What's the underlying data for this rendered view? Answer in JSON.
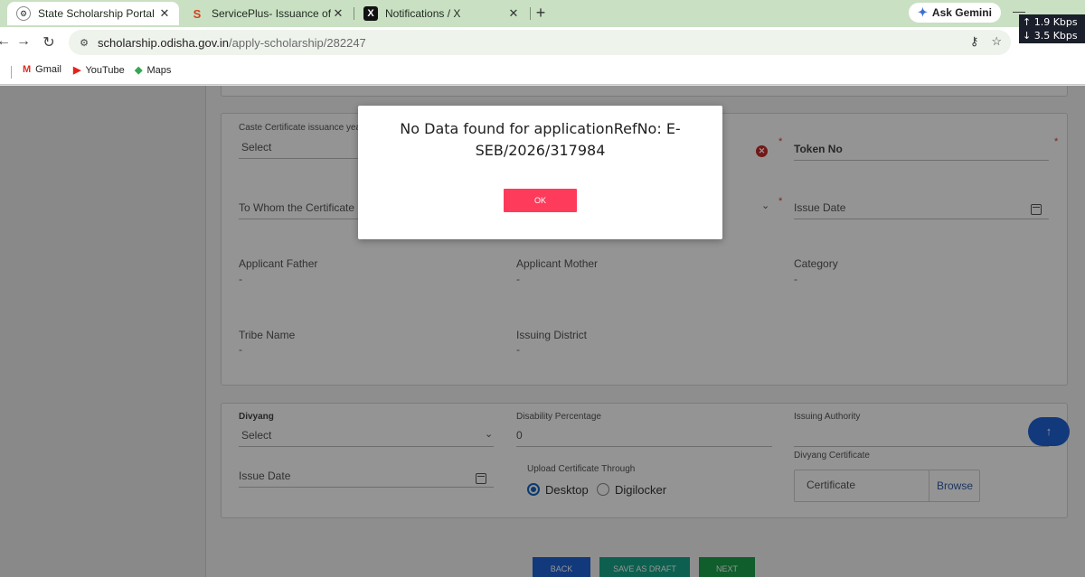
{
  "browser": {
    "tabs": [
      {
        "title": "State Scholarship Portal",
        "close": "✕"
      },
      {
        "title": "ServicePlus- Issuance of SEBC C",
        "close": "✕"
      },
      {
        "title": "Notifications / X",
        "close": "✕"
      }
    ],
    "new_tab": "+",
    "gemini_label": "Ask Gemini",
    "net_up": "↑ 1.9 Kbps",
    "net_down": "↓ 3.5 Kbps",
    "url_domain": "scholarship.odisha.gov.in",
    "url_path": "/apply-scholarship/282247",
    "bookmarks": [
      "Gmail",
      "YouTube",
      "Maps"
    ]
  },
  "form": {
    "caste_year_label": "Caste Certificate issuance year",
    "caste_year_value": "Select",
    "token_no_label": "Token No",
    "to_whom_label": "To Whom the Certificate Iss",
    "issue_date_label": "Issue Date",
    "applicant_father_label": "Applicant Father",
    "applicant_father_value": "-",
    "applicant_mother_label": "Applicant Mother",
    "applicant_mother_value": "-",
    "category_label": "Category",
    "category_value": "-",
    "tribe_name_label": "Tribe Name",
    "tribe_name_value": "-",
    "issuing_district_label": "Issuing District",
    "issuing_district_value": "-",
    "required_mark": "*",
    "divyang_label": "Divyang",
    "divyang_value": "Select",
    "disability_label": "Disability Percentage",
    "disability_value": "0",
    "issuing_authority_label": "Issuing Authority",
    "divyang_cert_label": "Divyang Certificate",
    "certificate_placeholder": "Certificate",
    "browse_label": "Browse",
    "issue_date2_label": "Issue Date",
    "upload_through_label": "Upload Certificate Through",
    "desktop_label": "Desktop",
    "digilocker_label": "Digilocker",
    "back_label": "BACK",
    "draft_label": "SAVE AS DRAFT",
    "next_label": "NEXT",
    "fab_icon": "↑"
  },
  "modal": {
    "message": "No Data found for applicationRefNo: E-SEB/2026/317984",
    "ok_label": "OK"
  }
}
